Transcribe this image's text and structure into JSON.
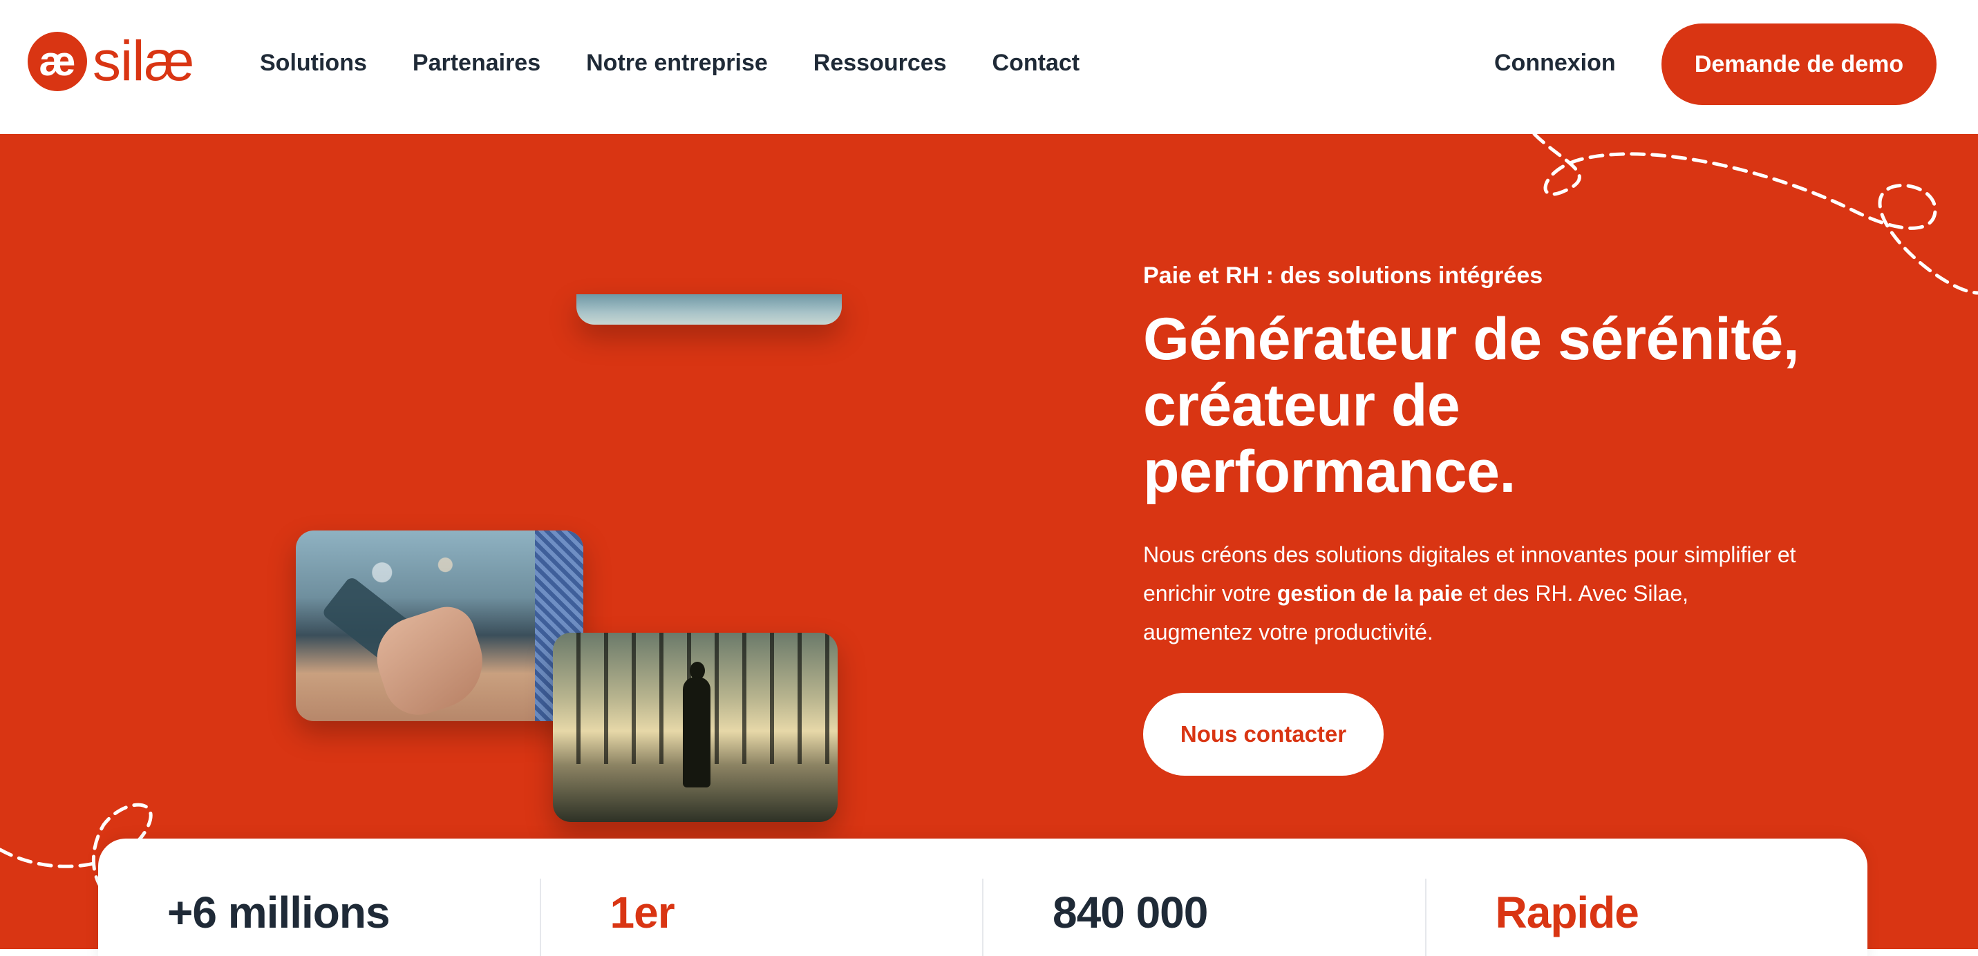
{
  "header": {
    "logo_text": "silæ",
    "logo_mark": "æ",
    "nav": [
      "Solutions",
      "Partenaires",
      "Notre entreprise",
      "Ressources",
      "Contact"
    ],
    "login_label": "Connexion",
    "demo_label": "Demande de demo"
  },
  "hero": {
    "eyebrow": "Paie et RH : des solutions intégrées",
    "title": "Générateur de sérénité, créateur de performance.",
    "desc_before": "Nous créons des solutions digitales et innovantes pour simplifier et enrichir votre ",
    "desc_bold": "gestion de la paie",
    "desc_after": " et des RH. Avec Silae, augmentez votre productivité.",
    "cta_label": "Nous contacter"
  },
  "stats": [
    {
      "value": "+6 millions",
      "accent": false
    },
    {
      "value": "1er",
      "accent": true
    },
    {
      "value": "840 000",
      "accent": false
    },
    {
      "value": "Rapide",
      "accent": true
    }
  ],
  "colors": {
    "brand": "#d93513",
    "text": "#1f2a37",
    "white": "#ffffff"
  }
}
